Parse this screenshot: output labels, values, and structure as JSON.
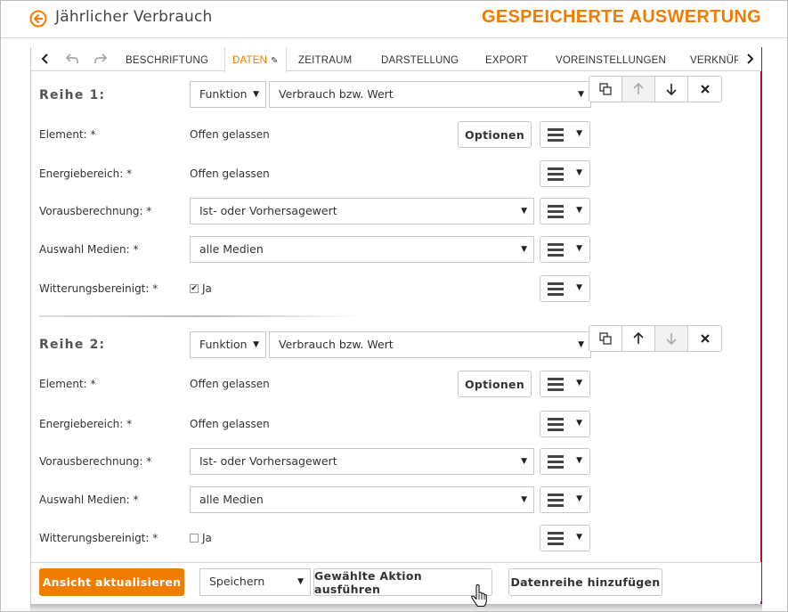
{
  "header": {
    "title": "Jährlicher Verbrauch",
    "section_title": "GESPEICHERTE AUSWERTUNG",
    "accent_color": "#f07d00"
  },
  "tabs": [
    {
      "label": "BESCHRIFTUNG",
      "active": false
    },
    {
      "label": "DATEN",
      "active": true
    },
    {
      "label": "ZEITRAUM",
      "active": false
    },
    {
      "label": "DARSTELLUNG",
      "active": false
    },
    {
      "label": "EXPORT",
      "active": false
    },
    {
      "label": "VOREINSTELLUNGEN",
      "active": false
    },
    {
      "label": "VERKNÜP",
      "active": false
    }
  ],
  "series": [
    {
      "title": "Reihe 1:",
      "function_select": "Funktion",
      "value_select": "Verbrauch bzw. Wert",
      "element_label": "Element: *",
      "element_value": "Offen gelassen",
      "options_button": "Optionen",
      "energy_label": "Energiebereich: *",
      "energy_value": "Offen gelassen",
      "forecast_label": "Vorausberechnung: *",
      "forecast_value": "Ist- oder Vorhersagewert",
      "media_label": "Auswahl Medien: *",
      "media_value": "alle Medien",
      "weather_label": "Witterungsbereinigt: *",
      "weather_checked": true,
      "weather_option": "Ja"
    },
    {
      "title": "Reihe 2:",
      "function_select": "Funktion",
      "value_select": "Verbrauch bzw. Wert",
      "element_label": "Element: *",
      "element_value": "Offen gelassen",
      "options_button": "Optionen",
      "energy_label": "Energiebereich: *",
      "energy_value": "Offen gelassen",
      "forecast_label": "Vorausberechnung: *",
      "forecast_value": "Ist- oder Vorhersagewert",
      "media_label": "Auswahl Medien: *",
      "media_value": "alle Medien",
      "weather_label": "Witterungsbereinigt: *",
      "weather_checked": false,
      "weather_option": "Ja"
    }
  ],
  "footer": {
    "refresh_button": "Ansicht aktualisieren",
    "action_select": "Speichern",
    "execute_button": "Gewählte Aktion ausführen",
    "add_series_button": "Datenreihe hinzufügen"
  }
}
